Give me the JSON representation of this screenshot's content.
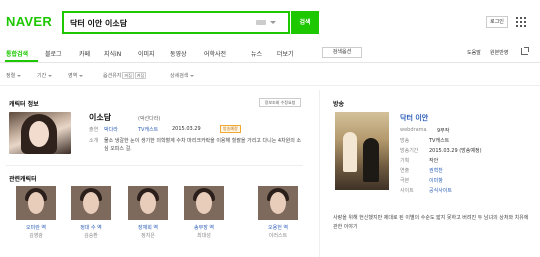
{
  "header": {
    "logo": "NAVER",
    "search_value": "닥터 이안 이소담",
    "search_button": "검색",
    "login_button": "로그인"
  },
  "nav": {
    "tabs": [
      "통합검색",
      "블로그",
      "카페",
      "지식iN",
      "이미지",
      "동영상",
      "어학사전",
      "뉴스",
      "더보기"
    ],
    "search_options": "검색옵션",
    "right_links": [
      "도움말",
      "원본반영"
    ]
  },
  "filters": {
    "items": [
      "정렬",
      "기간",
      "영역",
      "옵션유지",
      "상세검색"
    ],
    "option_chips": [
      "꺼짐",
      "켜짐"
    ]
  },
  "character": {
    "section_title": "캐릭터 정보",
    "edit_button": "정보조회 수정요청",
    "name": "이소담",
    "alias": "(박선다라)",
    "labels": [
      "출연",
      "소개"
    ],
    "actor": "박다라",
    "channel": "TV캐스트",
    "date": "2015.03.29",
    "badge": "방송예정",
    "description": "물소 냉갈한 눈이 생기한 의학혈계 수차 마리크카락을 이용해 힐괄을 가리고 다니는 4차원의 소심 오피스 걸."
  },
  "related": {
    "title": "관련캐릭터",
    "cards": [
      {
        "name": "오미란 역",
        "actor": "김영광"
      },
      {
        "name": "정대 수 역",
        "actor": "김승환"
      },
      {
        "name": "장재희 역",
        "actor": "정지은"
      },
      {
        "name": "송부장 역",
        "actor": "최대성"
      },
      {
        "name": "오용헌 역",
        "actor": "이러스트"
      }
    ]
  },
  "broadcast": {
    "section_title": "방송",
    "title": "닥터 이안",
    "rows": [
      {
        "label": "webdrama",
        "value": "9부작"
      },
      {
        "label": "방송",
        "value": "TV캐스트"
      },
      {
        "label": "방송기간",
        "value": "2015.03.29 (방송예정)"
      },
      {
        "label": "기획",
        "value": "작안"
      },
      {
        "label": "연출",
        "value": "권혁찬"
      },
      {
        "label": "극본",
        "value": "이미항"
      },
      {
        "label": "사이트",
        "value": "공식사이트"
      }
    ],
    "description": "사랑을 위해 헌신했지만 제대로 된 이별의 수순도 밟지 못하고 버려진 두 남녀의 상처와 치유에 관한 이야기"
  }
}
